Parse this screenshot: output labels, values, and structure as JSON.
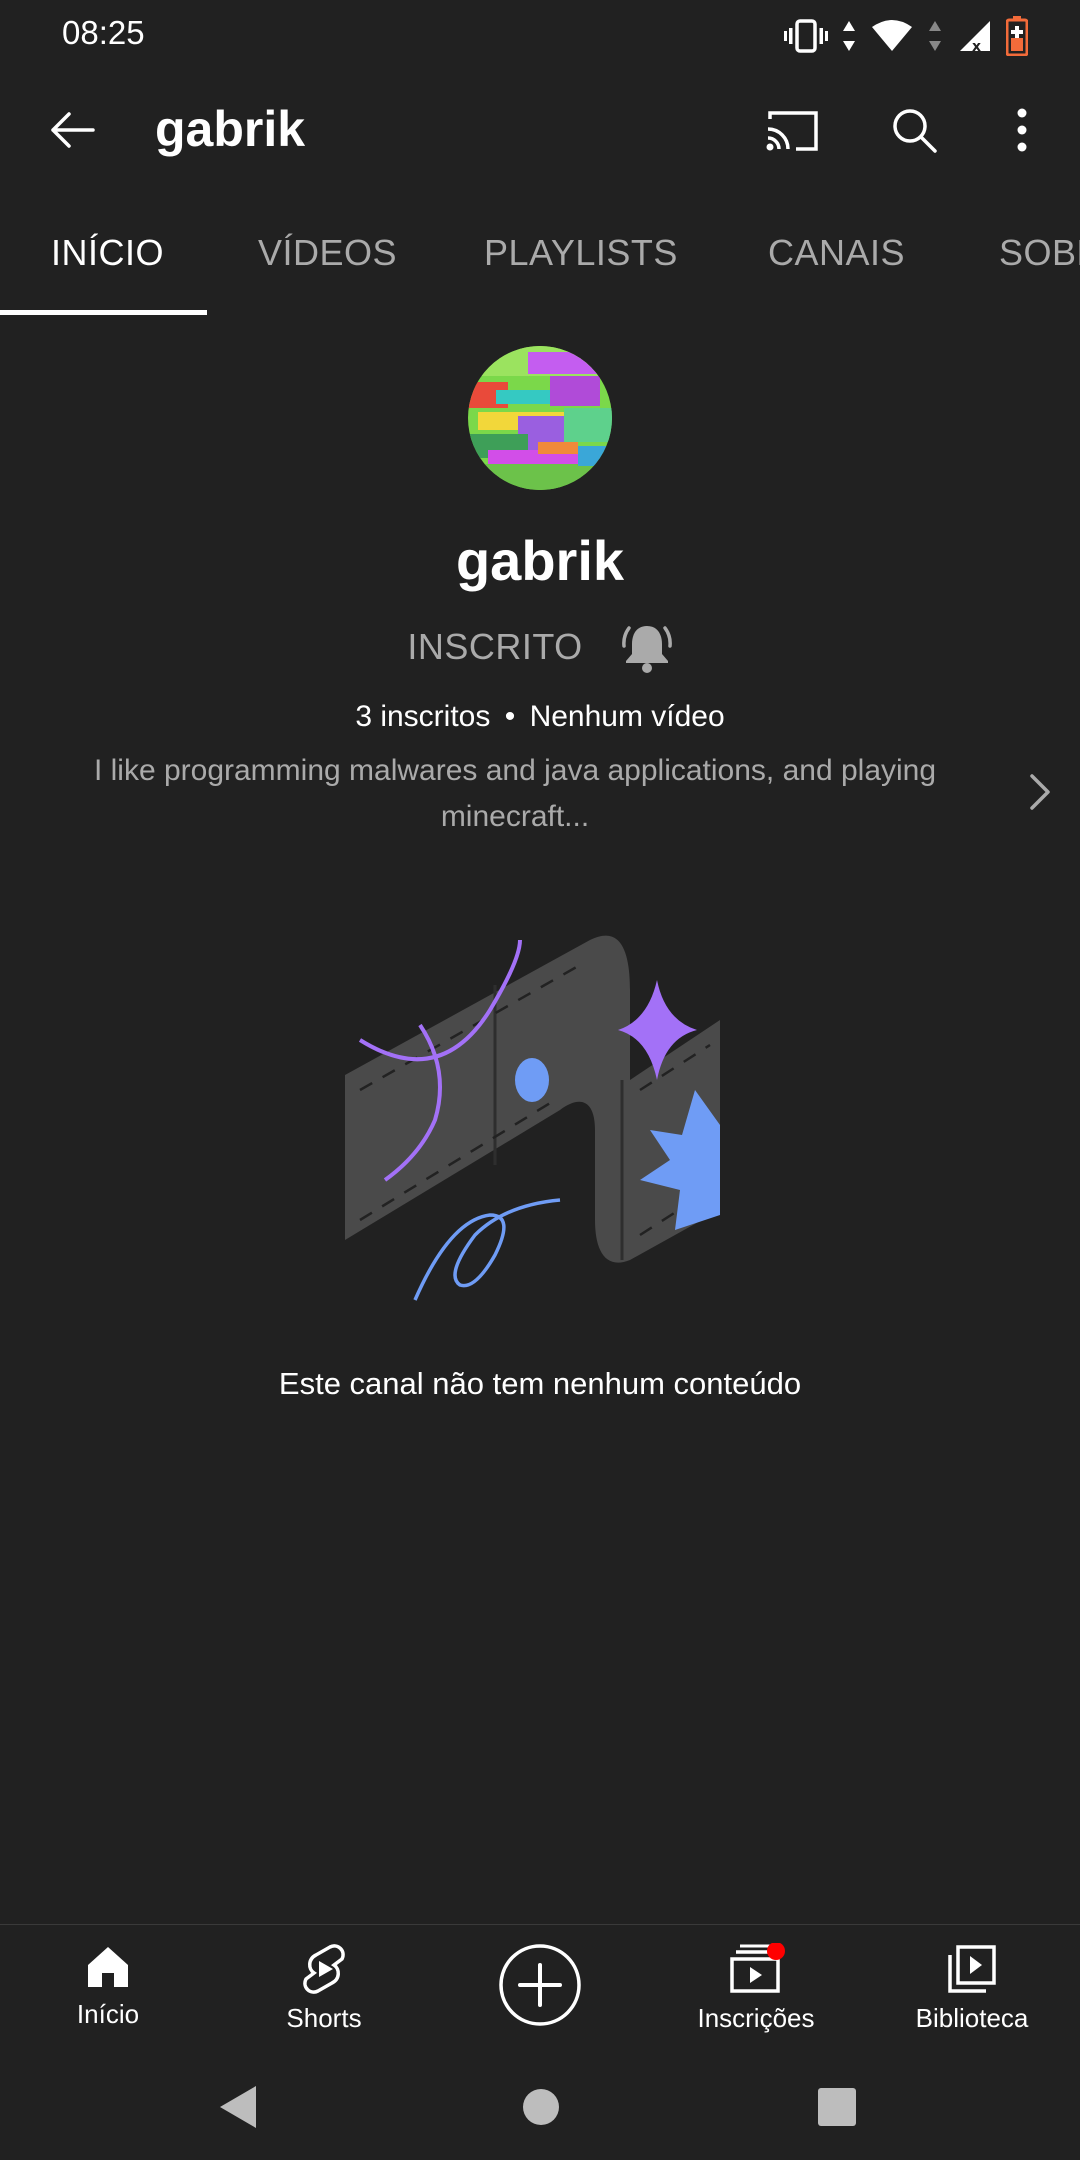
{
  "status_bar": {
    "time": "08:25"
  },
  "app_bar": {
    "title": "gabrik",
    "back_icon": "arrow-left-icon",
    "cast_icon": "cast-icon",
    "search_icon": "search-icon",
    "more_icon": "more-vert-icon"
  },
  "tabs": [
    {
      "label": "INÍCIO",
      "active": true
    },
    {
      "label": "VÍDEOS",
      "active": false
    },
    {
      "label": "PLAYLISTS",
      "active": false
    },
    {
      "label": "CANAIS",
      "active": false
    },
    {
      "label": "SOBRE",
      "active": false
    }
  ],
  "channel": {
    "name": "gabrik",
    "subscribed_label": "INSCRITO",
    "subscribers": "3 inscritos",
    "separator": "•",
    "videos": "Nenhum vídeo",
    "description": "I like programming malwares and java applications, and playing minecraft..."
  },
  "empty_state": {
    "message": "Este canal não tem nenhum conteúdo"
  },
  "bottom_nav": [
    {
      "label": "Início",
      "icon": "home-icon"
    },
    {
      "label": "Shorts",
      "icon": "shorts-icon"
    },
    {
      "label": "",
      "icon": "create-plus-icon"
    },
    {
      "label": "Inscrições",
      "icon": "subscriptions-icon"
    },
    {
      "label": "Biblioteca",
      "icon": "library-icon"
    }
  ],
  "colors": {
    "background": "#212121",
    "text_primary": "#ffffff",
    "text_secondary": "#aaaaaa",
    "notification_dot": "#ff0000",
    "accent_purple": "#a371f7",
    "accent_blue": "#6f9cf5"
  }
}
